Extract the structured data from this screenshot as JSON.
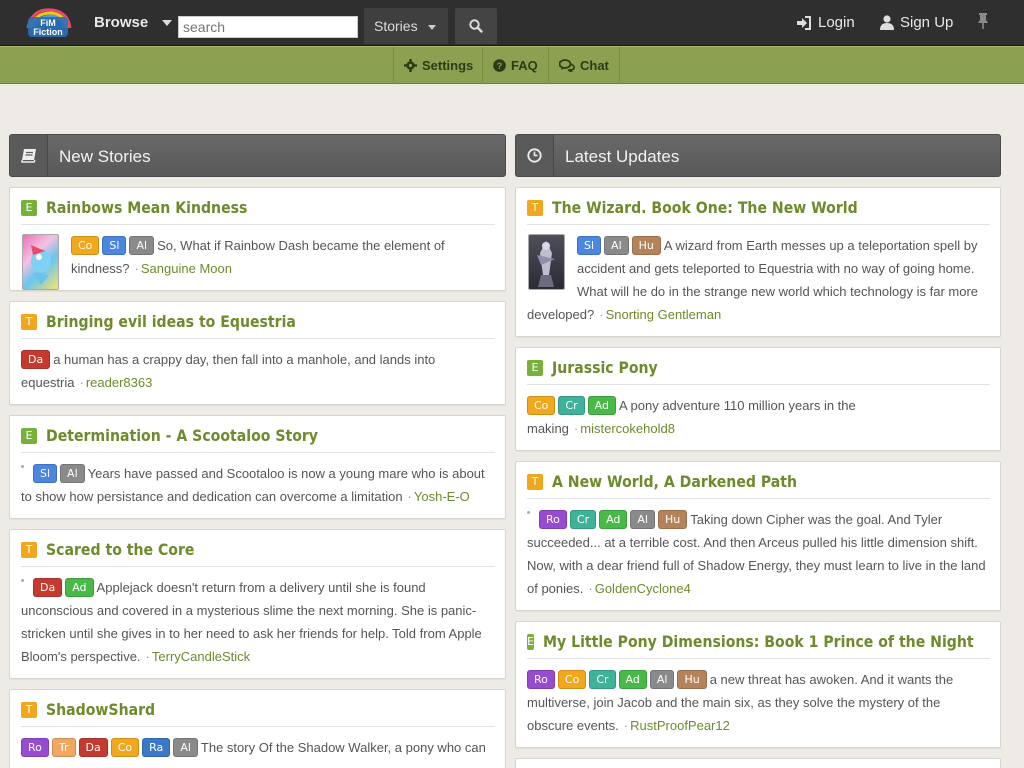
{
  "nav": {
    "logo_line1": "FiM",
    "logo_line2": "Fiction",
    "browse_label": "Browse",
    "search_placeholder": "search",
    "search_scope": "Stories",
    "login_label": "Login",
    "signup_label": "Sign Up"
  },
  "subnav": [
    {
      "label": "Settings",
      "icon": "gear-icon"
    },
    {
      "label": "FAQ",
      "icon": "question-circle-icon"
    },
    {
      "label": "Chat",
      "icon": "chat-bubbles-icon"
    }
  ],
  "columns": {
    "left_title": "New Stories",
    "right_title": "Latest Updates"
  },
  "tag_colors": {
    "Co": "#f1a81d",
    "Sl": "#4b86e0",
    "Al": "#8a8a8a",
    "Da": "#c43a2f",
    "Ad": "#49b948",
    "Hu": "#b5835a",
    "Cr": "#3fb29a",
    "Ro": "#974bcf",
    "Tr": "#f0a760",
    "Ra": "#3c78c8"
  },
  "rating_colors": {
    "E": "#78b13a",
    "T": "#f0a71d"
  },
  "new_stories": [
    {
      "rating": "E",
      "title": "Rainbows Mean Kindness",
      "thumb": true,
      "tags": [
        "Co",
        "Sl",
        "Al"
      ],
      "description": "So, What if Rainbow Dash became the element of kindness?",
      "author": "Sanguine Moon"
    },
    {
      "rating": "T",
      "title": "Bringing evil ideas to Equestria",
      "thumb": false,
      "tags": [
        "Da"
      ],
      "description": "a human has a crappy day, then fall into a manhole, and lands into equestria",
      "author": "reader8363"
    },
    {
      "rating": "E",
      "title": "Determination - A Scootaloo Story",
      "thumb": false,
      "bullet": true,
      "tags": [
        "Sl",
        "Al"
      ],
      "description": "Years have passed and Scootaloo is now a young mare who is about to show how persistance and dedication can overcome a limitation",
      "author": "Yosh-E-O"
    },
    {
      "rating": "T",
      "title": "Scared to the Core",
      "thumb": false,
      "bullet": true,
      "tags": [
        "Da",
        "Ad"
      ],
      "description": "Applejack doesn't return from a delivery until she is found unconscious and covered in a mysterious slime the next morning. She is panic-stricken until she gives in to her need to ask her friends for help. Told from Apple Bloom's perspective.",
      "author": "TerryCandleStick"
    },
    {
      "rating": "T",
      "title": "ShadowShard",
      "thumb": false,
      "tags": [
        "Ro",
        "Tr",
        "Da",
        "Co",
        "Ra",
        "Al"
      ],
      "description": "The story Of the Shadow Walker, a pony who can",
      "author": ""
    }
  ],
  "latest_updates": [
    {
      "rating": "T",
      "title": "The Wizard. Book One: The New World",
      "thumb": true,
      "tags": [
        "Sl",
        "Al",
        "Hu"
      ],
      "description": "A wizard from Earth messes up a teleportation spell by accident and gets teleported to Equestria with no way of going home. What will he do in the strange new world which technology is far more developed?",
      "author": "Snorting Gentleman"
    },
    {
      "rating": "E",
      "title": "Jurassic Pony",
      "thumb": false,
      "tags": [
        "Co",
        "Cr",
        "Ad"
      ],
      "description": "A pony adventure 110 million years in the making",
      "author": "mistercokehold8"
    },
    {
      "rating": "T",
      "title": "A New World, A Darkened Path",
      "thumb": false,
      "bullet": true,
      "tags": [
        "Ro",
        "Cr",
        "Ad",
        "Al",
        "Hu"
      ],
      "description": "Taking down Cipher was the goal. And Tyler succeeded... at a terrible cost. And then Arceus pulled his little dimension shift. Now, with a dear friend full of Shadow Energy, they must learn to live in the land of ponies.",
      "author": "GoldenCyclone4"
    },
    {
      "rating": "E",
      "title": "My Little Pony Dimensions: Book 1 Prince of the Night",
      "thumb": false,
      "tags": [
        "Ro",
        "Co",
        "Cr",
        "Ad",
        "Al",
        "Hu"
      ],
      "description": "a new threat has awoken. And it wants the multiverse, join Jacob and the main six, as they solve the mystery of the obscure events.",
      "author": "RustProofPear12"
    }
  ]
}
